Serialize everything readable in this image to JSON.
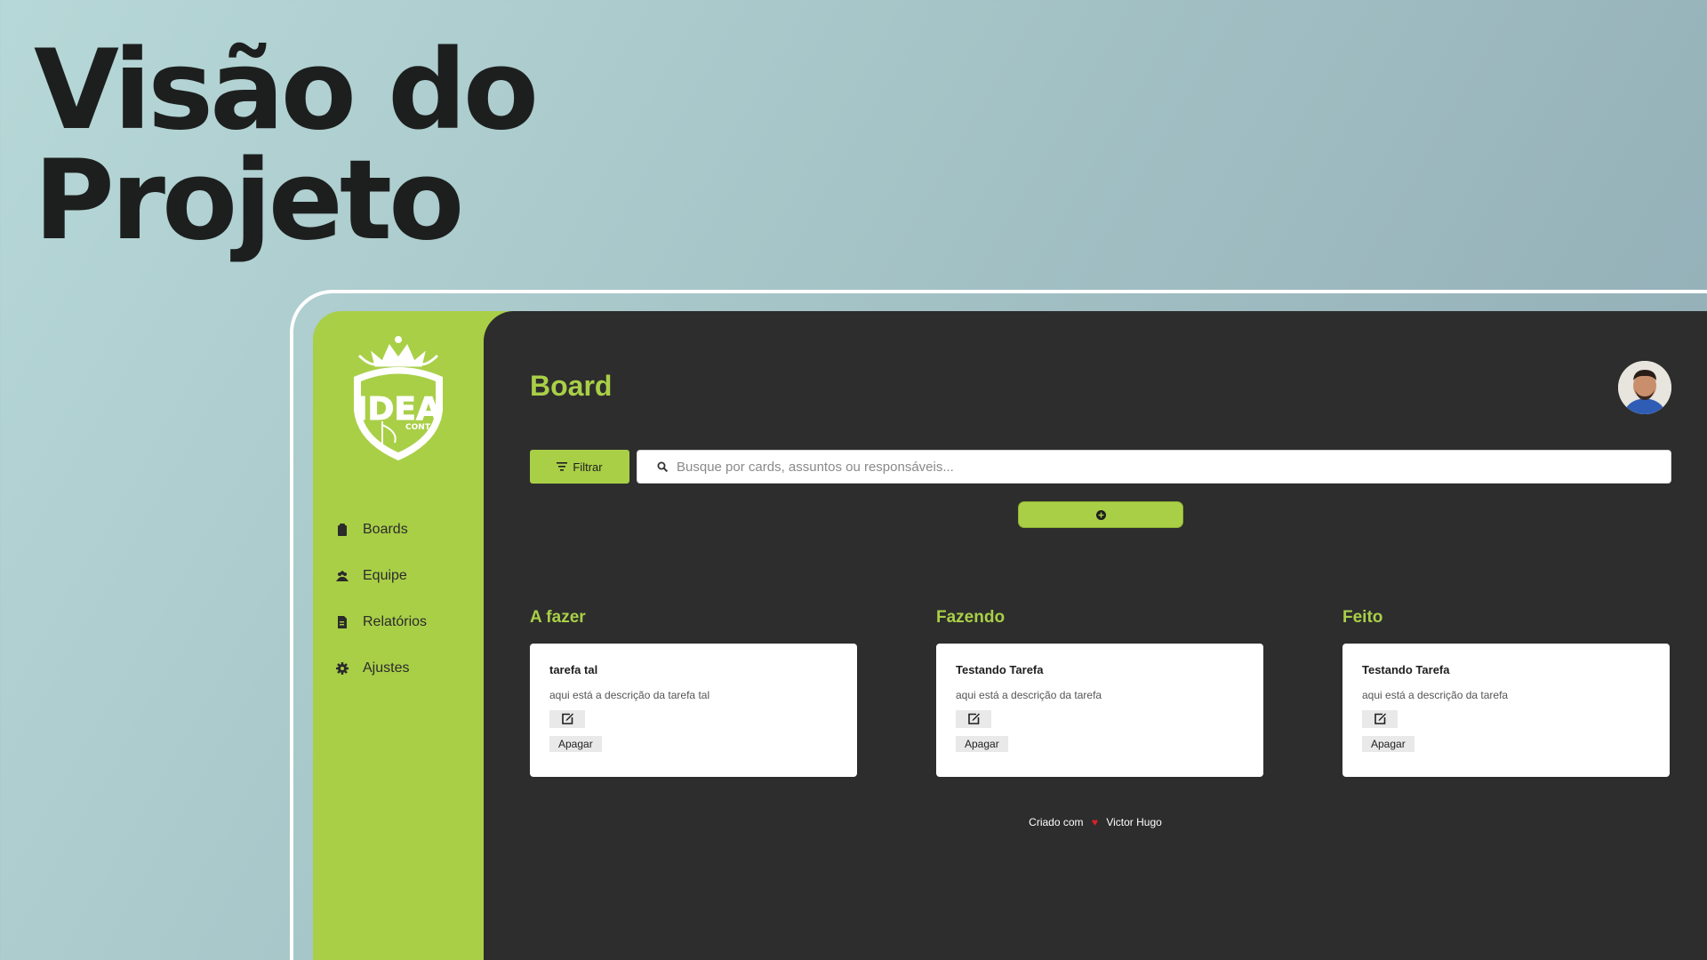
{
  "hero": {
    "line1": "Visão do",
    "line2": "Projeto"
  },
  "colors": {
    "accent": "#a9cf47",
    "main_bg": "#2d2d2d",
    "heart": "#e0202a"
  },
  "sidebar": {
    "logo_text": "IDEA",
    "logo_sub": "CONT",
    "items": [
      {
        "label": "Boards",
        "icon": "clipboard-icon"
      },
      {
        "label": "Equipe",
        "icon": "team-icon"
      },
      {
        "label": "Relatórios",
        "icon": "report-icon"
      },
      {
        "label": "Ajustes",
        "icon": "gear-icon"
      }
    ]
  },
  "header": {
    "title": "Board"
  },
  "toolbar": {
    "filter_label": "Filtrar",
    "search_placeholder": "Busque por cards, assuntos ou responsáveis..."
  },
  "columns": [
    {
      "title": "A fazer",
      "cards": [
        {
          "title": "tarefa tal",
          "description": "aqui está a descrição da tarefa tal",
          "delete_label": "Apagar"
        }
      ]
    },
    {
      "title": "Fazendo",
      "cards": [
        {
          "title": "Testando Tarefa",
          "description": "aqui está a descrição da tarefa",
          "delete_label": "Apagar"
        }
      ]
    },
    {
      "title": "Feito",
      "cards": [
        {
          "title": "Testando Tarefa",
          "description": "aqui está a descrição da tarefa",
          "delete_label": "Apagar"
        }
      ]
    }
  ],
  "footer": {
    "prefix": "Criado com",
    "heart": "♥",
    "author": "Victor Hugo"
  }
}
